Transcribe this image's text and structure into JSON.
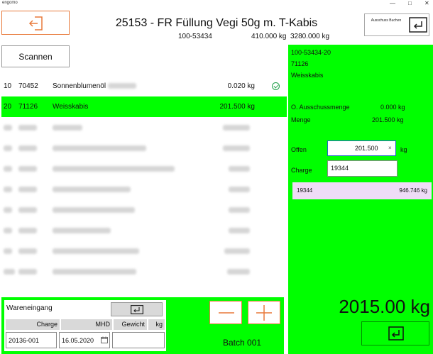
{
  "app": {
    "title": "engomo",
    "controls": {
      "min": "—",
      "max": "□",
      "close": "✕"
    }
  },
  "header": {
    "title": "25153 - FR Füllung Vegi 50g m. T-Kabis",
    "order_code": "100-53434",
    "qty_actual": "410.000 kg",
    "qty_planned": "3280.000 kg",
    "book_button_label": "Ausschuss Buchen",
    "back_icon": "exit-arrow-icon",
    "book_icon": "return-enter-icon"
  },
  "actions": {
    "scan_label": "Scannen"
  },
  "list": {
    "rows": [
      {
        "pos": "10",
        "article": "70452",
        "name": "Sonnenblumenöl",
        "qty": "0.020 kg",
        "status": "done",
        "selected": false
      },
      {
        "pos": "20",
        "article": "71126",
        "name": "Weisskabis",
        "qty": "201.500 kg",
        "status": "",
        "selected": true
      }
    ],
    "redacted_row_count": 8
  },
  "detail": {
    "lot_code": "100-53434-20",
    "article": "71126",
    "name": "Weisskabis",
    "scrap_label": "O. Ausschussmenge",
    "scrap_value": "0.000 kg",
    "amount_label": "Menge",
    "amount_value": "201.500 kg",
    "open_label": "Offen",
    "open_value": "201.500",
    "open_unit": "kg",
    "clear_icon": "×",
    "charge_label": "Charge",
    "charge_value": "19344",
    "lots": [
      {
        "lot": "19344",
        "qty": "946.746 kg"
      }
    ],
    "total": "2015.00 kg"
  },
  "goods_receipt": {
    "title": "Wareneingang",
    "headers": {
      "charge": "Charge",
      "mhd": "MHD",
      "weight": "Gewicht",
      "unit": "kg"
    },
    "charge_value": "20136-001",
    "mhd_value": "16.05.2020",
    "weight_value": "",
    "minus_label": "—",
    "plus_label": "+",
    "batch_label": "Batch 001"
  },
  "colors": {
    "accent": "#e8793a",
    "highlight": "#00ff00",
    "lot_row": "#efdcf7",
    "input_focus": "#1e63c8"
  }
}
